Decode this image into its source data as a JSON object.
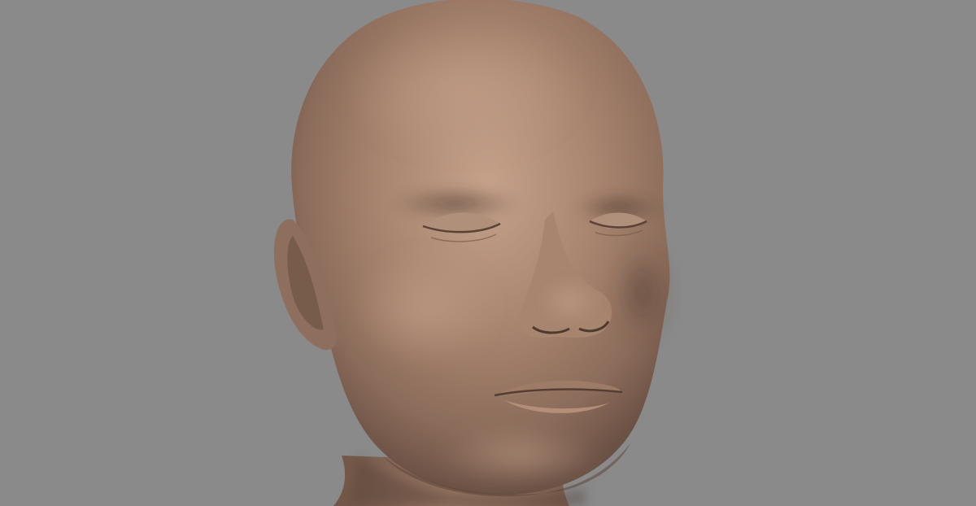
{
  "viewport": {
    "background_color": "#8a8a8a",
    "subject": "sculpted-head-model",
    "material_color": "#9c7a66",
    "material_highlight": "#c8a48e",
    "material_shadow": "#5e463a"
  }
}
